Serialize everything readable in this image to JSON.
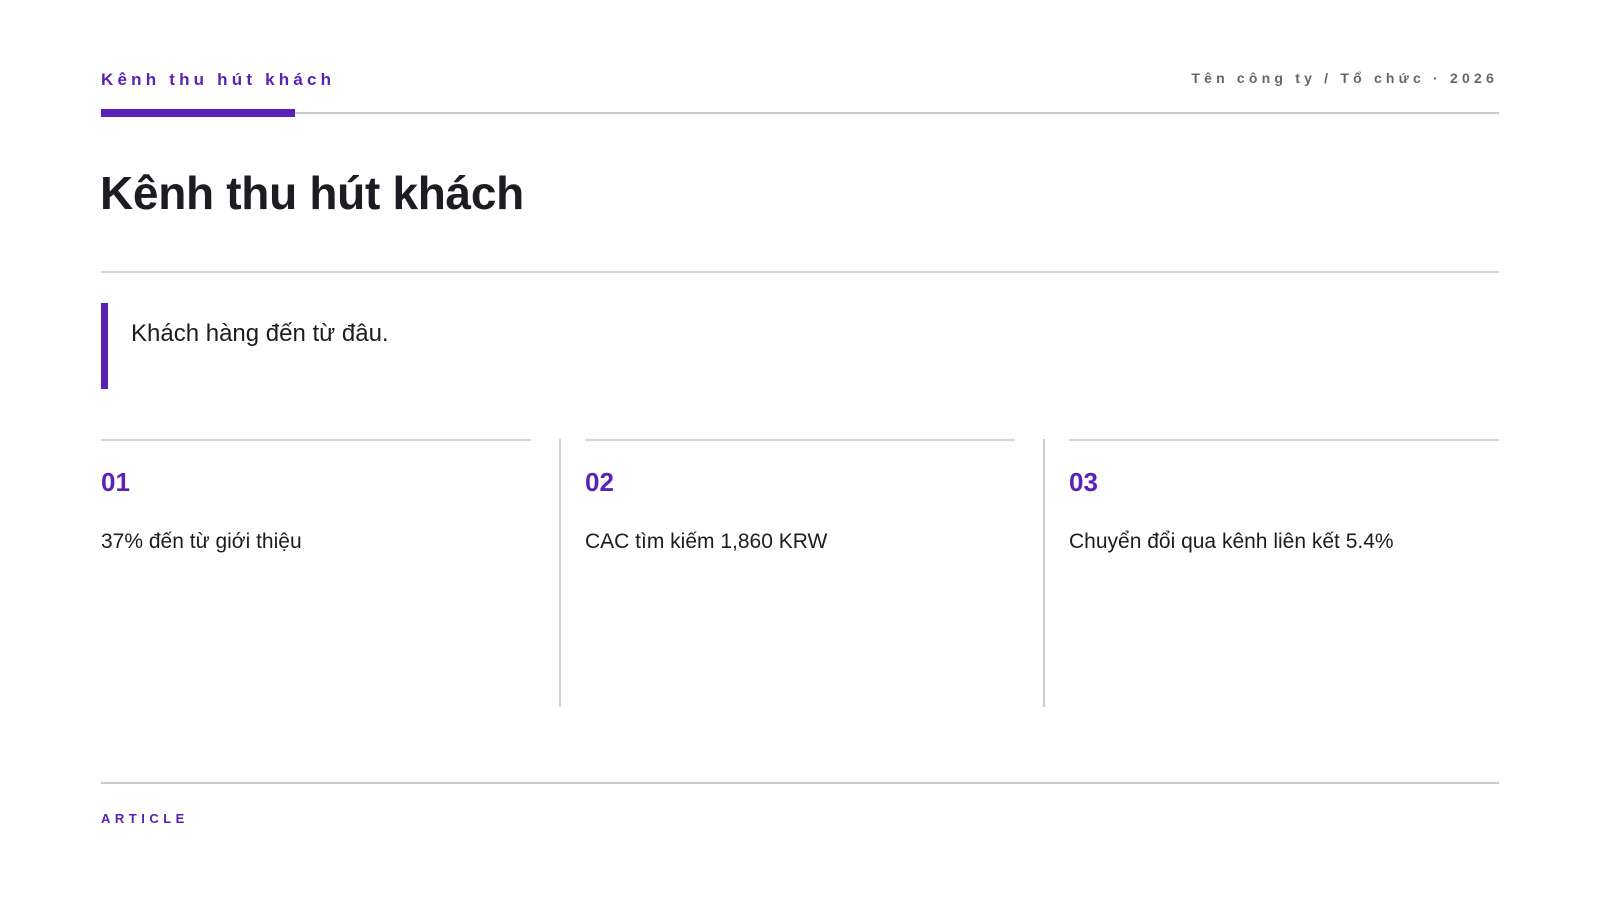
{
  "header": {
    "kicker": "Kênh thu hút khách",
    "meta": "Tên công ty / Tổ chức · 2026"
  },
  "title": "Kênh thu hút khách",
  "quote": "Khách hàng đến từ đâu.",
  "cards": [
    {
      "number": "01",
      "text": "37% đến từ giới thiệu"
    },
    {
      "number": "02",
      "text": "CAC tìm kiếm 1,860 KRW"
    },
    {
      "number": "03",
      "text": "Chuyển đổi qua kênh liên kết 5.4%"
    }
  ],
  "footer": {
    "label": "ARTICLE"
  },
  "colors": {
    "accent": "#5b21b6",
    "text": "#1c1c22",
    "muted": "#666670",
    "rule": "#c9c9cc"
  }
}
